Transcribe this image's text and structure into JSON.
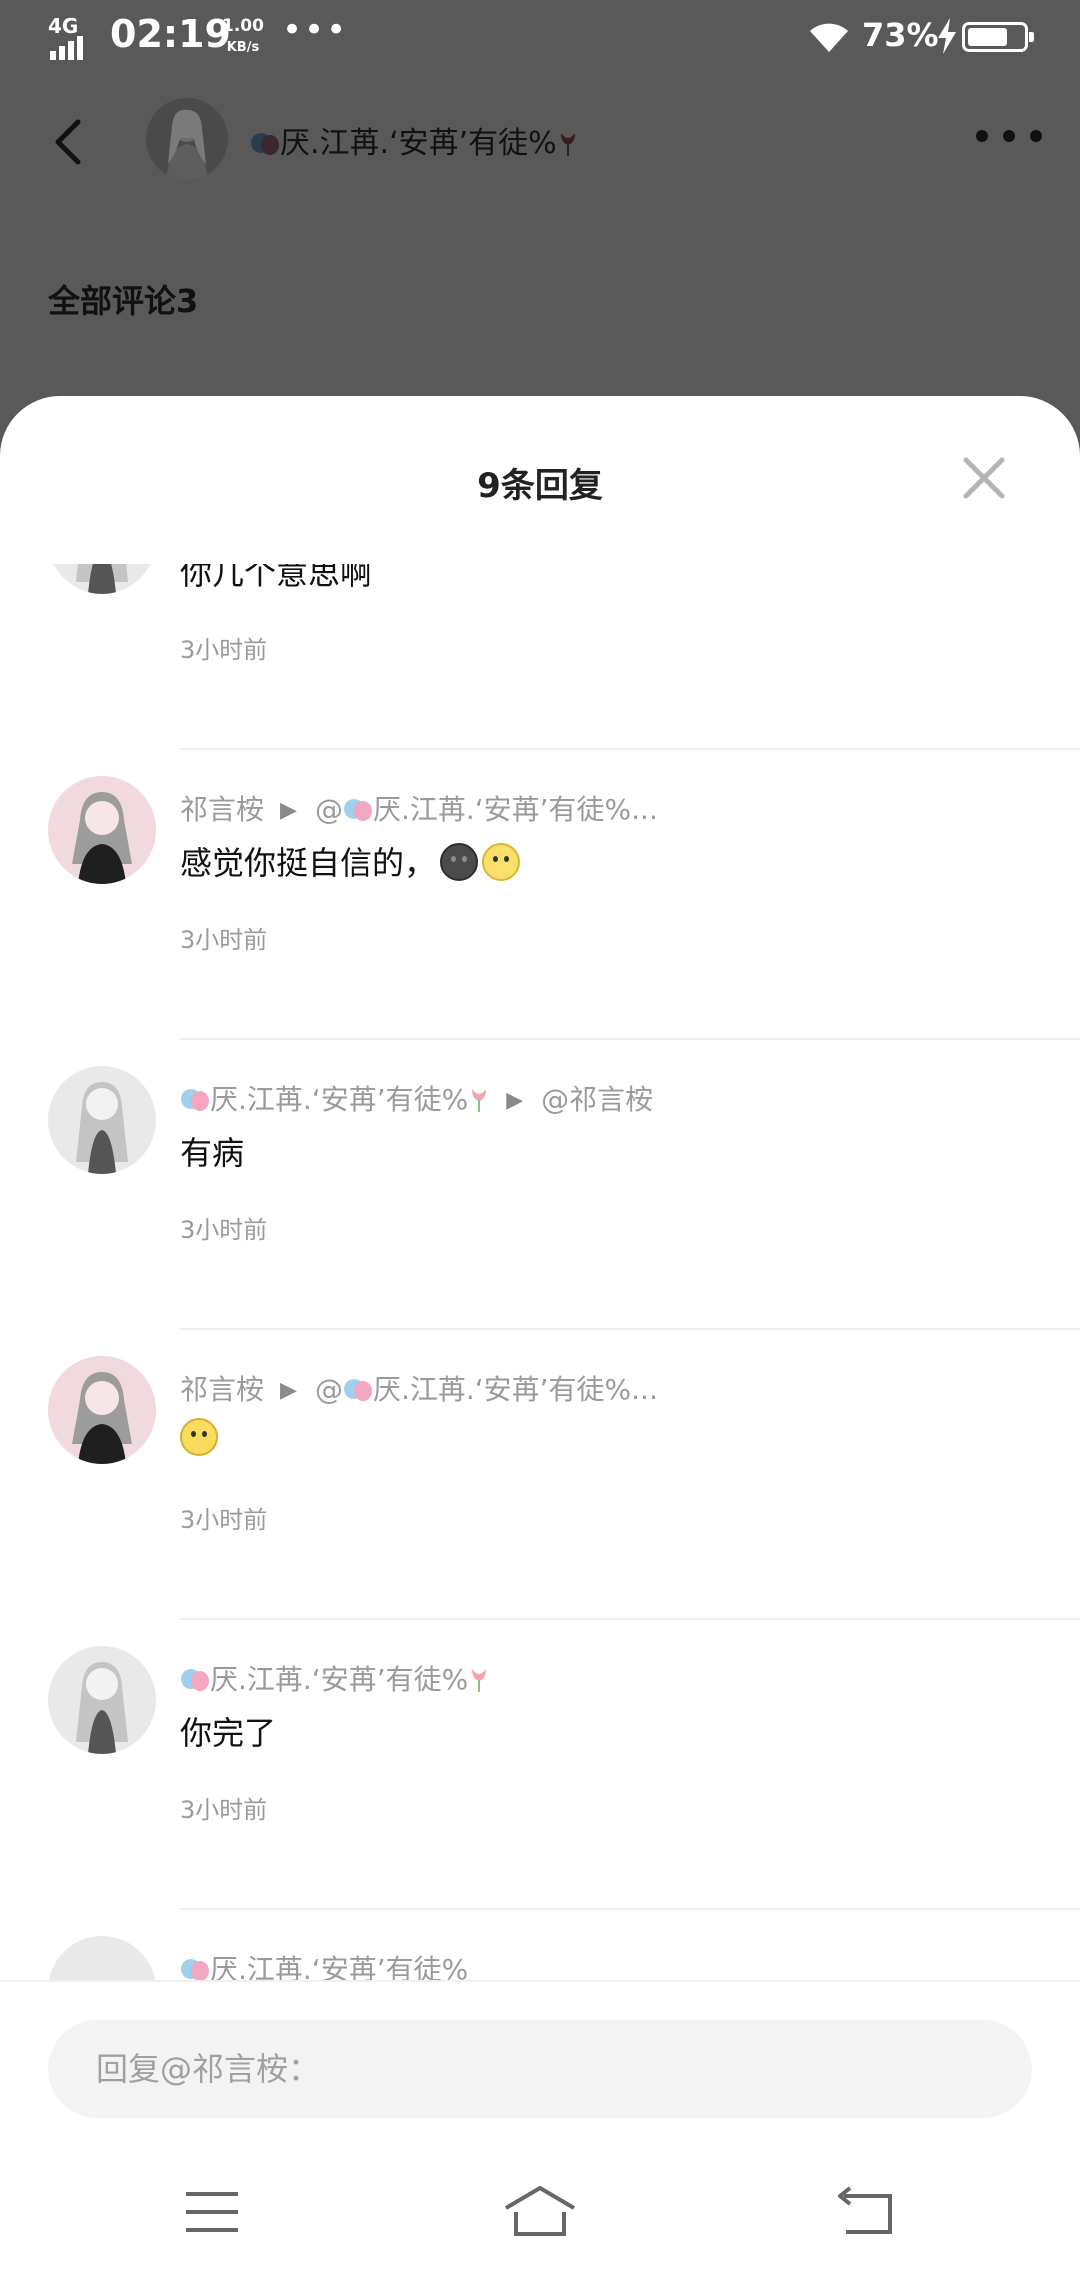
{
  "status_bar": {
    "network": "4G",
    "time": "02:19",
    "speed_value": "1.00",
    "speed_unit": "KB/s",
    "dots": "•••",
    "battery_pct": "73%",
    "battery_level": 0.73
  },
  "header": {
    "author_name": "厌.江苒.‘安苒’有徒%"
  },
  "all_comments_label": "全部评论3",
  "sheet": {
    "title": "9条回复"
  },
  "replies": [
    {
      "from": "",
      "arrow": "",
      "to": "",
      "text": "你几个意思啊",
      "time": "3小时前"
    },
    {
      "from": "祁言桉",
      "arrow": "▶",
      "to": "@",
      "to_name": "厌.江苒.‘安苒’有徒%...",
      "text": "感觉你挺自信的，",
      "time": "3小时前"
    },
    {
      "from": "厌.江苒.‘安苒’有徒%",
      "arrow": "▶",
      "to": "@祁言桉",
      "text": "有病",
      "time": "3小时前"
    },
    {
      "from": "祁言桉",
      "arrow": "▶",
      "to": "@",
      "to_name": "厌.江苒.‘安苒’有徒%...",
      "text": "",
      "time": "3小时前"
    },
    {
      "from": "厌.江苒.‘安苒’有徒%",
      "text": "你完了",
      "time": "3小时前"
    }
  ],
  "input": {
    "placeholder": "回复@祁言桉："
  },
  "icons": {
    "back": "back-arrow-icon",
    "more": "more-dots-icon",
    "close": "close-icon",
    "menu": "menu-icon",
    "home": "home-icon",
    "return": "return-icon"
  }
}
